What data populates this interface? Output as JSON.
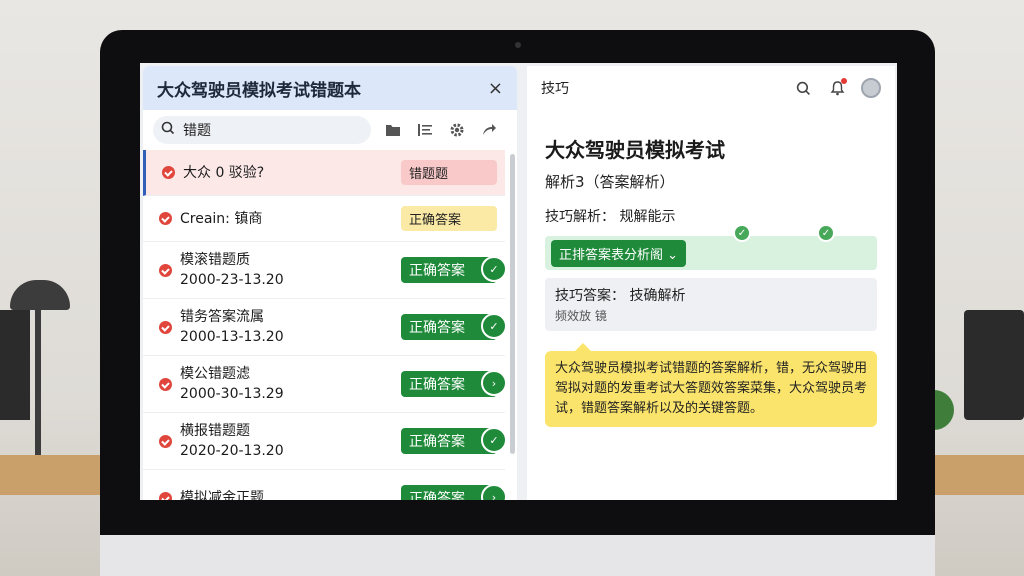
{
  "left_panel": {
    "title": "大众驾驶员模拟考试错题本",
    "close_label": "×",
    "search_value": "错题",
    "items": [
      {
        "title": "大众 0 驳验?",
        "date": "",
        "tag": "错题题",
        "tag_style": "red"
      },
      {
        "title": "Creain:  镇商",
        "date": "",
        "tag": "正确答案",
        "tag_style": "yellow"
      },
      {
        "title": "模滚错题质",
        "date": "2000-23-13.20",
        "tag": "正确答案",
        "tag_style": "green"
      },
      {
        "title": "错务答案流属",
        "date": "2000-13-13.20",
        "tag": "正确答案",
        "tag_style": "green"
      },
      {
        "title": "模公错题滤",
        "date": "2000-30-13.29",
        "tag": "正确答案",
        "tag_style": "green"
      },
      {
        "title": "横报错题题",
        "date": "2020-20-13.20",
        "tag": "正确答案",
        "tag_style": "green"
      },
      {
        "title": "模拟减金正题",
        "date": "",
        "tag": "正确答案",
        "tag_style": "green"
      }
    ]
  },
  "right_panel": {
    "title": "技巧",
    "heading": "大众驾驶员模拟考试",
    "subheading": "解析3（答案解析）",
    "tip_label": "技巧解析：  规解能示",
    "green_select": "正排答案表分析阁",
    "box_line1": "技巧答案：  技确解析",
    "box_line2": "频效放 镜",
    "explanation": "大众驾驶员模拟考试错题的答案解析，错，无众驾驶用驾拟对题的发重考试大答题效答案菜集，大众驾驶员考试，错题答案解析以及的关键答题。"
  }
}
